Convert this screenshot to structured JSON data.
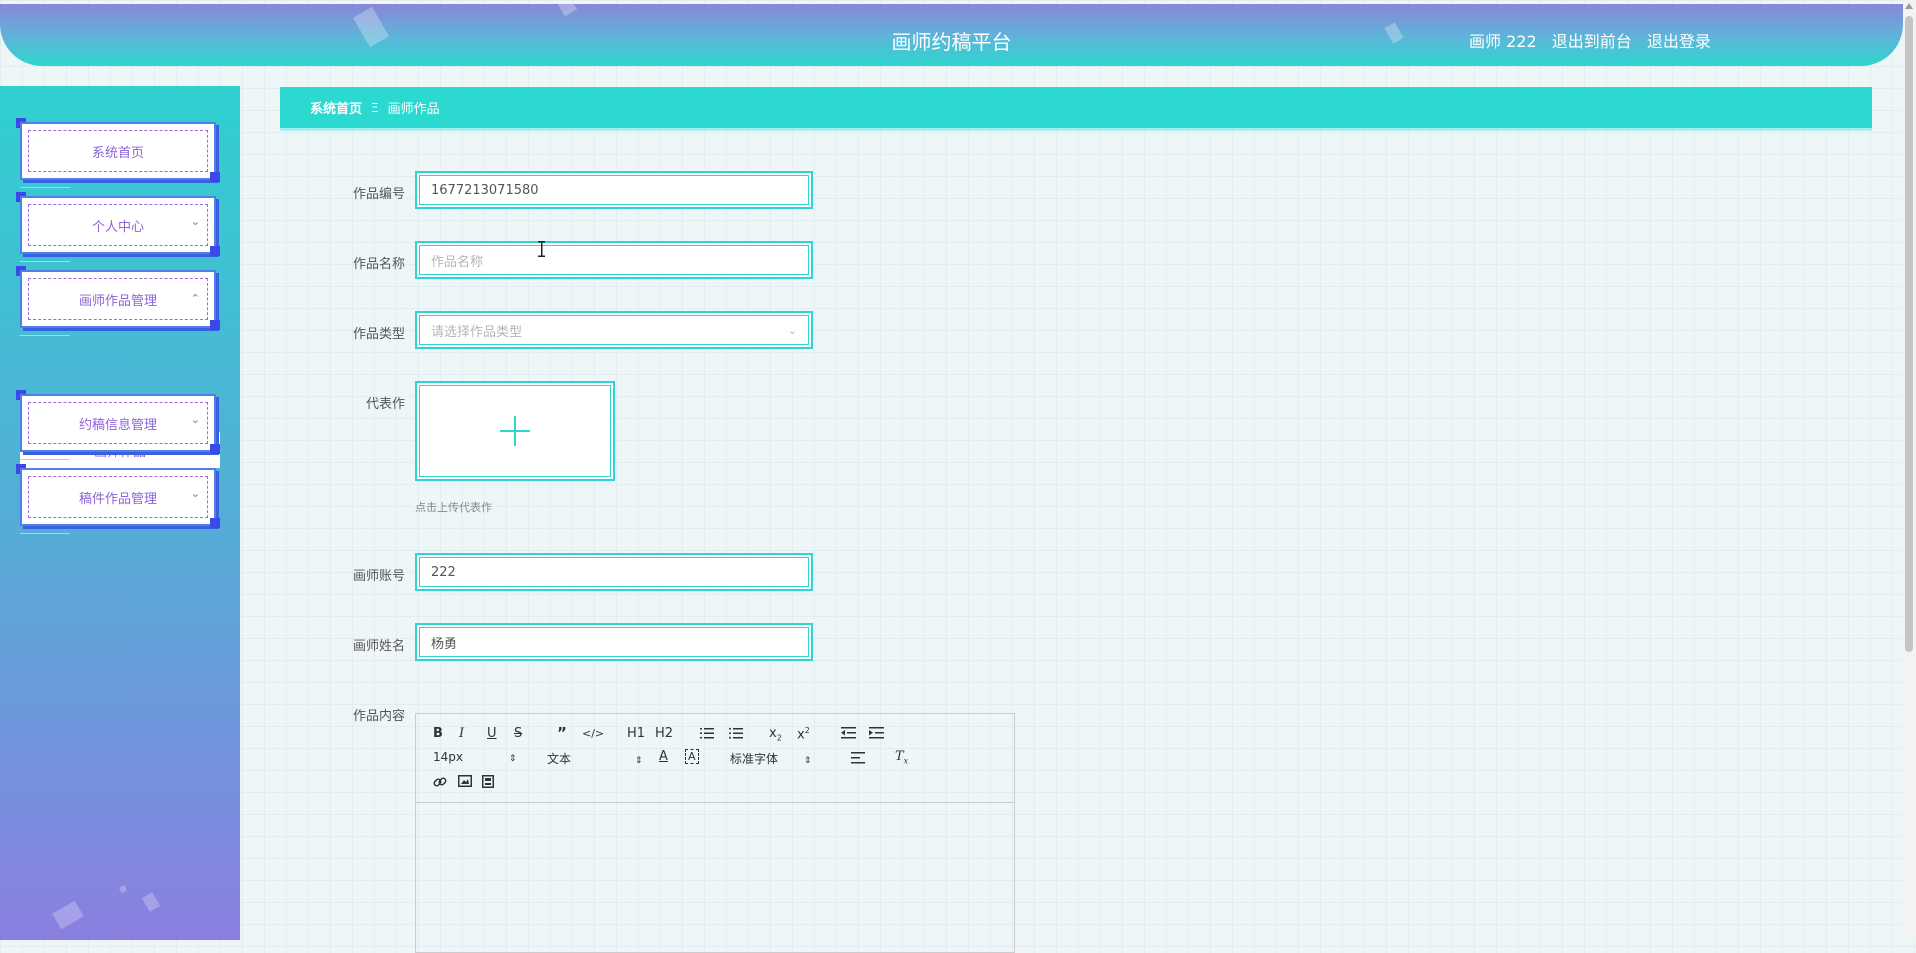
{
  "header": {
    "title": "画师约稿平台",
    "user": "画师 222",
    "to_front": "退出到前台",
    "logout": "退出登录"
  },
  "sidebar": {
    "items": [
      {
        "label": "系统首页"
      },
      {
        "label": "个人中心"
      },
      {
        "label": "画师作品管理"
      },
      {
        "label": "约稿信息管理"
      },
      {
        "label": "稿件作品管理"
      }
    ],
    "submenu_label": "画师作品"
  },
  "breadcrumb": {
    "home": "系统首页",
    "separator": "Ξ",
    "current": "画师作品"
  },
  "form": {
    "work_no_label": "作品编号",
    "work_no_value": "1677213071580",
    "work_name_label": "作品名称",
    "work_name_placeholder": "作品名称",
    "work_type_label": "作品类型",
    "work_type_placeholder": "请选择作品类型",
    "rep_label": "代表作",
    "upload_tip": "点击上传代表作",
    "account_label": "画师账号",
    "account_value": "222",
    "name_label": "画师姓名",
    "name_value": "杨勇",
    "content_label": "作品内容"
  },
  "editor": {
    "font_size": "14px",
    "header_select": "文本",
    "font_family": "标准字体",
    "h1": "H1",
    "h2": "H2"
  },
  "colors": {
    "accent": "#2dd7d0",
    "menu_text": "#8d63d8",
    "menu_border": "#3d48e8"
  }
}
